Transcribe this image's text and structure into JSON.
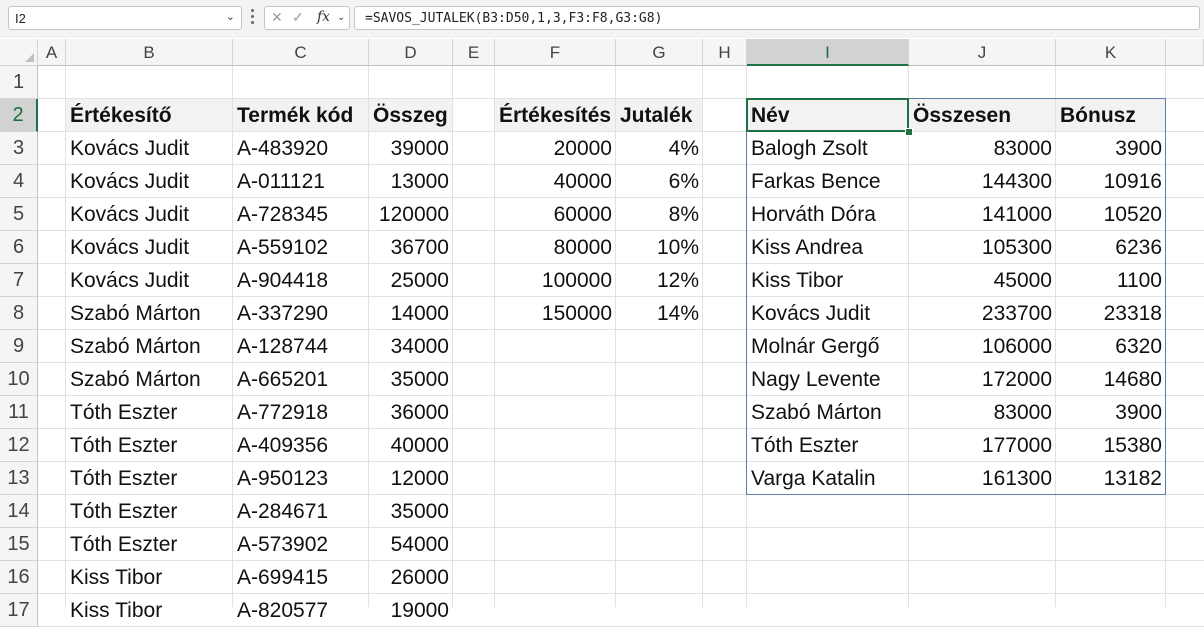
{
  "formula_bar": {
    "name_box": "I2",
    "cancel_icon": "✕",
    "confirm_icon": "✓",
    "fx_label": "fx",
    "formula": "=SAVOS_JUTALEK(B3:D50,1,3,F3:F8,G3:G8)"
  },
  "columns": [
    "A",
    "B",
    "C",
    "D",
    "E",
    "F",
    "G",
    "H",
    "I",
    "J",
    "K"
  ],
  "rows": [
    "1",
    "2",
    "3",
    "4",
    "5",
    "6",
    "7",
    "8",
    "9",
    "10",
    "11",
    "12",
    "13",
    "14",
    "15",
    "16",
    "17"
  ],
  "selected_column": "I",
  "selected_row": "2",
  "sales_table": {
    "headers": [
      "Értékesítő",
      "Termék kód",
      "Összeg"
    ],
    "rows": [
      [
        "Kovács Judit",
        "A-483920",
        "39000"
      ],
      [
        "Kovács Judit",
        "A-011121",
        "13000"
      ],
      [
        "Kovács Judit",
        "A-728345",
        "120000"
      ],
      [
        "Kovács Judit",
        "A-559102",
        "36700"
      ],
      [
        "Kovács Judit",
        "A-904418",
        "25000"
      ],
      [
        "Szabó Márton",
        "A-337290",
        "14000"
      ],
      [
        "Szabó Márton",
        "A-128744",
        "34000"
      ],
      [
        "Szabó Márton",
        "A-665201",
        "35000"
      ],
      [
        "Tóth Eszter",
        "A-772918",
        "36000"
      ],
      [
        "Tóth Eszter",
        "A-409356",
        "40000"
      ],
      [
        "Tóth Eszter",
        "A-950123",
        "12000"
      ],
      [
        "Tóth Eszter",
        "A-284671",
        "35000"
      ],
      [
        "Tóth Eszter",
        "A-573902",
        "54000"
      ],
      [
        "Kiss Tibor",
        "A-699415",
        "26000"
      ],
      [
        "Kiss Tibor",
        "A-820577",
        "19000"
      ]
    ]
  },
  "bonus_tiers": {
    "headers": [
      "Értékesítés",
      "Jutalék"
    ],
    "rows": [
      [
        "20000",
        "4%"
      ],
      [
        "40000",
        "6%"
      ],
      [
        "60000",
        "8%"
      ],
      [
        "80000",
        "10%"
      ],
      [
        "100000",
        "12%"
      ],
      [
        "150000",
        "14%"
      ]
    ]
  },
  "result_table": {
    "headers": [
      "Név",
      "Összesen",
      "Bónusz"
    ],
    "rows": [
      [
        "Balogh Zsolt",
        "83000",
        "3900"
      ],
      [
        "Farkas Bence",
        "144300",
        "10916"
      ],
      [
        "Horváth Dóra",
        "141000",
        "10520"
      ],
      [
        "Kiss Andrea",
        "105300",
        "6236"
      ],
      [
        "Kiss Tibor",
        "45000",
        "1100"
      ],
      [
        "Kovács Judit",
        "233700",
        "23318"
      ],
      [
        "Molnár Gergő",
        "106000",
        "6320"
      ],
      [
        "Nagy Levente",
        "172000",
        "14680"
      ],
      [
        "Szabó Márton",
        "83000",
        "3900"
      ],
      [
        "Tóth Eszter",
        "177000",
        "15380"
      ],
      [
        "Varga Katalin",
        "161300",
        "13182"
      ]
    ]
  }
}
